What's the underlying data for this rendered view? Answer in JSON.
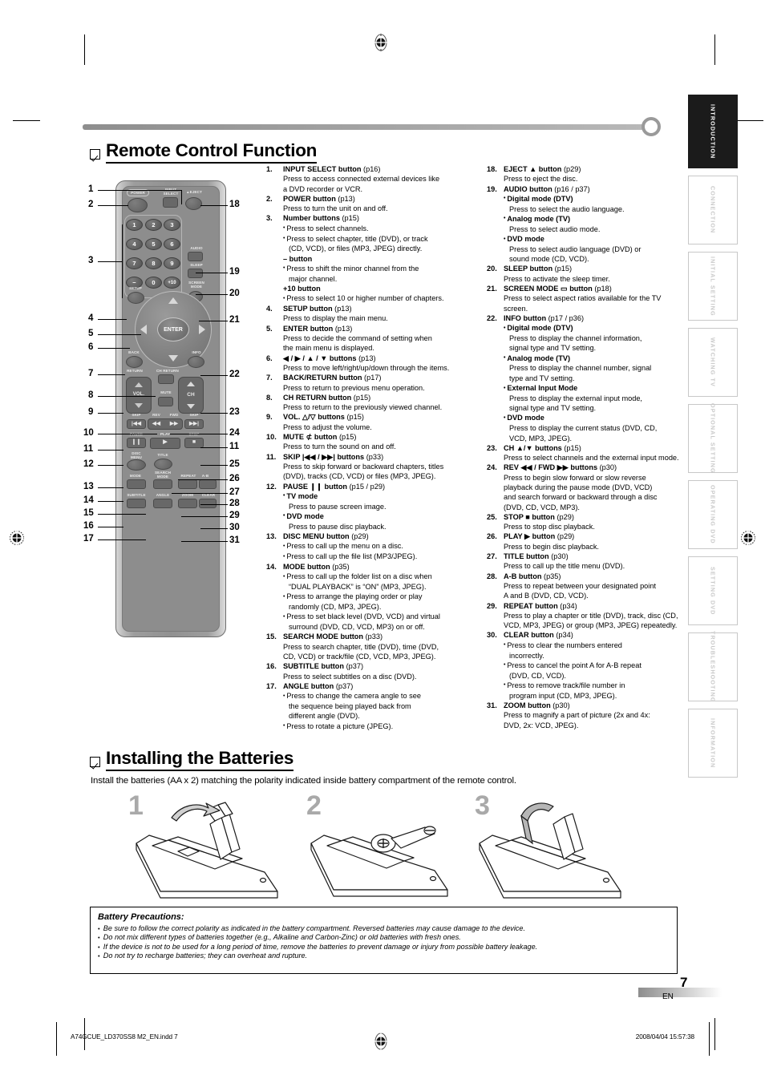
{
  "page": {
    "number": "7",
    "language": "EN",
    "footer_file": "A74GCUE_LD370SS8 M2_EN.indd   7",
    "footer_timestamp": "2008/04/04   15:57:38"
  },
  "side_tabs": [
    {
      "label": "INTRODUCTION",
      "active": true
    },
    {
      "label": "CONNECTION",
      "active": false
    },
    {
      "label": "INITIAL  SETTING",
      "active": false
    },
    {
      "label": "WATCHING  TV",
      "active": false
    },
    {
      "label": "OPTIONAL  SETTING",
      "active": false
    },
    {
      "label": "OPERATING  DVD",
      "active": false
    },
    {
      "label": "SETTING  DVD",
      "active": false
    },
    {
      "label": "TROUBLESHOOTING",
      "active": false
    },
    {
      "label": "INFORMATION",
      "active": false
    }
  ],
  "section1": {
    "title": "Remote Control Function"
  },
  "section2": {
    "title": "Installing the Batteries",
    "intro": "Install the batteries (AA x 2) matching the polarity indicated inside battery compartment of the remote control.",
    "steps": [
      "1",
      "2",
      "3"
    ]
  },
  "precautions": {
    "title": "Battery Precautions:",
    "items": [
      "Be sure to follow the correct polarity as indicated in the battery compartment. Reversed batteries may cause damage to the device.",
      "Do not mix different types of batteries together (e.g., Alkaline and Carbon-Zinc) or old batteries with fresh ones.",
      "If the device is not to be used for a long period of time, remove the batteries to prevent damage or injury from possible battery leakage.",
      "Do not try to recharge batteries; they can overheat and rupture."
    ]
  },
  "remote_labels": {
    "power": "POWER",
    "input_select": "INPUT\nSELECT",
    "eject": "▲EJECT",
    "audio": "AUDIO",
    "sleep": "SLEEP",
    "screen_mode": "SCREEN\nMODE",
    "setup": "SETUP",
    "enter": "ENTER",
    "back": "BACK",
    "return": "RETURN",
    "info": "INFO",
    "ch_return": "CH RETURN",
    "vol": "VOL.",
    "mute": "MUTE",
    "ch": "CH",
    "skip_left": "SKIP",
    "skip_right": "SKIP",
    "rev": "REV",
    "fwd": "FWD",
    "pause": "PAUSE",
    "play": "PLAY",
    "stop": "STOP",
    "disc_menu": "DISC\nMENU",
    "title": "TITLE",
    "mode": "MODE",
    "search_mode": "SEARCH\nMODE",
    "repeat": "REPEAT",
    "ab": "A-B",
    "subtitle": "SUBTITLE",
    "angle": "ANGLE",
    "zoom": "ZOOM",
    "clear": "CLEAR",
    "keys": [
      "1",
      "2",
      "3",
      "4",
      "5",
      "6",
      "7",
      "8",
      "9",
      "−",
      "0",
      "+10"
    ]
  },
  "callouts": [
    "1",
    "2",
    "3",
    "4",
    "5",
    "6",
    "7",
    "8",
    "9",
    "10",
    "11",
    "12",
    "13",
    "14",
    "15",
    "16",
    "17",
    "18",
    "19",
    "20",
    "21",
    "22",
    "23",
    "24",
    "25",
    "26",
    "27",
    "28",
    "29",
    "30",
    "31",
    "11"
  ],
  "functions_left": [
    {
      "n": "1.",
      "title": "INPUT SELECT button",
      "page": "(p16)",
      "lines": [
        {
          "t": "plain",
          "v": "Press to access connected external devices like"
        },
        {
          "t": "plain",
          "v": "a DVD recorder or VCR."
        }
      ]
    },
    {
      "n": "2.",
      "title": "POWER button",
      "page": "(p13)",
      "lines": [
        {
          "t": "plain",
          "v": "Press to turn the unit on and off."
        }
      ]
    },
    {
      "n": "3.",
      "title": "Number buttons",
      "page": "(p15)",
      "lines": [
        {
          "t": "bullet",
          "v": "Press to select channels."
        },
        {
          "t": "bullet",
          "v": "Press to select chapter, title (DVD), or track"
        },
        {
          "t": "indent",
          "v": "(CD, VCD), or files (MP3, JPEG) directly."
        },
        {
          "t": "boldline",
          "v": "– button"
        },
        {
          "t": "bullet",
          "v": "Press to shift the minor channel from the"
        },
        {
          "t": "indent",
          "v": "major channel."
        },
        {
          "t": "boldline",
          "v": "+10 button"
        },
        {
          "t": "bullet",
          "v": "Press to select 10 or higher number of chapters."
        }
      ]
    },
    {
      "n": "4.",
      "title": "SETUP button",
      "page": "(p13)",
      "lines": [
        {
          "t": "plain",
          "v": "Press to display the main menu."
        }
      ]
    },
    {
      "n": "5.",
      "title": "ENTER button",
      "page": "(p13)",
      "lines": [
        {
          "t": "plain",
          "v": "Press to decide the command of setting when"
        },
        {
          "t": "plain",
          "v": "the main menu is displayed."
        }
      ]
    },
    {
      "n": "6.",
      "title": "◀ / ▶ / ▲ / ▼ buttons",
      "page": "(p13)",
      "lines": [
        {
          "t": "plain",
          "v": "Press to move left/right/up/down through the items."
        }
      ]
    },
    {
      "n": "7.",
      "title": "BACK/RETURN button",
      "page": "(p17)",
      "lines": [
        {
          "t": "plain",
          "v": "Press to return to previous menu operation."
        }
      ]
    },
    {
      "n": "8.",
      "title": "CH RETURN button",
      "page": "(p15)",
      "lines": [
        {
          "t": "plain",
          "v": "Press to return to the previously viewed channel."
        }
      ]
    },
    {
      "n": "9.",
      "title": "VOL. △/▽ buttons",
      "page": "(p15)",
      "lines": [
        {
          "t": "plain",
          "v": "Press to adjust the volume."
        }
      ]
    },
    {
      "n": "10.",
      "title": "MUTE ⊄ button",
      "page": "(p15)",
      "lines": [
        {
          "t": "plain",
          "v": "Press to turn the sound on and off."
        }
      ]
    },
    {
      "n": "11.",
      "title": "SKIP |◀◀ / ▶▶| buttons",
      "page": "(p33)",
      "lines": [
        {
          "t": "plain",
          "v": "Press to skip forward or backward chapters, titles"
        },
        {
          "t": "plain",
          "v": "(DVD), tracks (CD, VCD) or files (MP3, JPEG)."
        }
      ]
    },
    {
      "n": "12.",
      "title": "PAUSE ❙❙ button",
      "page": "(p15 / p29)",
      "lines": [
        {
          "t": "sub",
          "v": "TV mode"
        },
        {
          "t": "indent",
          "v": "Press to pause screen image."
        },
        {
          "t": "sub",
          "v": "DVD mode"
        },
        {
          "t": "indent",
          "v": "Press to pause disc playback."
        }
      ]
    },
    {
      "n": "13.",
      "title": "DISC MENU button",
      "page": "(p29)",
      "lines": [
        {
          "t": "bullet",
          "v": "Press to call up the menu on a disc."
        },
        {
          "t": "bullet",
          "v": "Press to call up the file list (MP3/JPEG)."
        }
      ]
    },
    {
      "n": "14.",
      "title": "MODE button",
      "page": "(p35)",
      "lines": [
        {
          "t": "bullet",
          "v": "Press to call up the folder list on a disc when"
        },
        {
          "t": "indent",
          "v": "“DUAL PLAYBACK” is “ON” (MP3, JPEG)."
        },
        {
          "t": "bullet",
          "v": "Press to arrange the playing order or play"
        },
        {
          "t": "indent",
          "v": "randomly (CD, MP3, JPEG)."
        },
        {
          "t": "bullet",
          "v": "Press to set black level (DVD, VCD) and virtual"
        },
        {
          "t": "indent",
          "v": "surround (DVD, CD, VCD, MP3) on or off."
        }
      ]
    },
    {
      "n": "15.",
      "title": "SEARCH MODE button",
      "page": "(p33)",
      "lines": [
        {
          "t": "plain",
          "v": "Press to search chapter, title (DVD), time (DVD,"
        },
        {
          "t": "plain",
          "v": "CD, VCD) or track/file (CD, VCD, MP3, JPEG)."
        }
      ]
    },
    {
      "n": "16.",
      "title": "SUBTITLE button",
      "page": "(p37)",
      "lines": [
        {
          "t": "plain",
          "v": "Press to select subtitles on a disc (DVD)."
        }
      ]
    },
    {
      "n": "17.",
      "title": "ANGLE button",
      "page": "(p37)",
      "lines": [
        {
          "t": "bullet",
          "v": "Press to change the camera angle to see"
        },
        {
          "t": "indent",
          "v": "the sequence being played back from"
        },
        {
          "t": "indent",
          "v": "different angle (DVD)."
        },
        {
          "t": "bullet",
          "v": "Press to rotate a picture (JPEG)."
        }
      ]
    }
  ],
  "functions_right": [
    {
      "n": "18.",
      "title": "EJECT ▲ button",
      "page": "(p29)",
      "lines": [
        {
          "t": "plain",
          "v": "Press to eject the disc."
        }
      ]
    },
    {
      "n": "19.",
      "title": "AUDIO button",
      "page": "(p16 / p37)",
      "lines": [
        {
          "t": "sub",
          "v": "Digital mode (DTV)"
        },
        {
          "t": "indent",
          "v": "Press to select the audio language."
        },
        {
          "t": "sub",
          "v": "Analog mode (TV)"
        },
        {
          "t": "indent",
          "v": "Press to select audio mode."
        },
        {
          "t": "sub",
          "v": "DVD mode"
        },
        {
          "t": "indent",
          "v": "Press to select audio language (DVD) or"
        },
        {
          "t": "indent",
          "v": "sound mode (CD, VCD)."
        }
      ]
    },
    {
      "n": "20.",
      "title": "SLEEP button",
      "page": "(p15)",
      "lines": [
        {
          "t": "plain",
          "v": "Press to activate the sleep timer."
        }
      ]
    },
    {
      "n": "21.",
      "title": "SCREEN MODE ▭ button",
      "page": "(p18)",
      "lines": [
        {
          "t": "plain",
          "v": "Press to select aspect ratios available for the TV screen."
        }
      ]
    },
    {
      "n": "22.",
      "title": "INFO button",
      "page": "(p17 / p36)",
      "lines": [
        {
          "t": "sub",
          "v": "Digital mode (DTV)"
        },
        {
          "t": "indent",
          "v": "Press to display the channel information,"
        },
        {
          "t": "indent",
          "v": "signal type and TV setting."
        },
        {
          "t": "sub",
          "v": "Analog mode (TV)"
        },
        {
          "t": "indent",
          "v": "Press to display the channel number, signal"
        },
        {
          "t": "indent",
          "v": "type and TV setting."
        },
        {
          "t": "sub",
          "v": "External Input Mode"
        },
        {
          "t": "indent",
          "v": "Press to display the external input mode,"
        },
        {
          "t": "indent",
          "v": "signal type and TV setting."
        },
        {
          "t": "sub",
          "v": "DVD mode"
        },
        {
          "t": "indent",
          "v": "Press to display the current status (DVD, CD,"
        },
        {
          "t": "indent",
          "v": "VCD, MP3, JPEG)."
        }
      ]
    },
    {
      "n": "23.",
      "title": "CH ▲/▼ buttons",
      "page": "(p15)",
      "lines": [
        {
          "t": "plain",
          "v": "Press to select channels and the external input mode."
        }
      ]
    },
    {
      "n": "24.",
      "title": "REV ◀◀ / FWD ▶▶ buttons",
      "page": "(p30)",
      "lines": [
        {
          "t": "plain",
          "v": "Press to begin slow forward or slow reverse"
        },
        {
          "t": "plain",
          "v": "playback during the pause mode (DVD, VCD)"
        },
        {
          "t": "plain",
          "v": "and search forward or backward through a disc"
        },
        {
          "t": "plain",
          "v": "(DVD, CD, VCD, MP3)."
        }
      ]
    },
    {
      "n": "25.",
      "title": "STOP ■ button",
      "page": "(p29)",
      "lines": [
        {
          "t": "plain",
          "v": "Press to stop disc playback."
        }
      ]
    },
    {
      "n": "26.",
      "title": "PLAY ▶ button",
      "page": "(p29)",
      "lines": [
        {
          "t": "plain",
          "v": "Press to begin disc playback."
        }
      ]
    },
    {
      "n": "27.",
      "title": "TITLE button",
      "page": "(p30)",
      "lines": [
        {
          "t": "plain",
          "v": "Press to call up the title menu (DVD)."
        }
      ]
    },
    {
      "n": "28.",
      "title": "A-B button",
      "page": "(p35)",
      "lines": [
        {
          "t": "plain",
          "v": "Press to repeat between your designated point"
        },
        {
          "t": "plain",
          "v": "A and B (DVD, CD, VCD)."
        }
      ]
    },
    {
      "n": "29.",
      "title": "REPEAT button",
      "page": "(p34)",
      "lines": [
        {
          "t": "plain",
          "v": "Press to play a chapter or title (DVD), track, disc (CD,"
        },
        {
          "t": "plain",
          "v": "VCD, MP3, JPEG) or group (MP3, JPEG) repeatedly."
        }
      ]
    },
    {
      "n": "30.",
      "title": "CLEAR button",
      "page": "(p34)",
      "lines": [
        {
          "t": "bullet",
          "v": "Press to clear the numbers entered"
        },
        {
          "t": "indent",
          "v": "incorrectly."
        },
        {
          "t": "bullet",
          "v": "Press to cancel the point A for A-B repeat"
        },
        {
          "t": "indent",
          "v": "(DVD, CD, VCD)."
        },
        {
          "t": "bullet",
          "v": "Press to remove track/file number in"
        },
        {
          "t": "indent",
          "v": "program input (CD, MP3, JPEG)."
        }
      ]
    },
    {
      "n": "31.",
      "title": "ZOOM button",
      "page": "(p30)",
      "lines": [
        {
          "t": "plain",
          "v": "Press to magnify a part of picture (2x and 4x:"
        },
        {
          "t": "plain",
          "v": "DVD, 2x: VCD, JPEG)."
        }
      ]
    }
  ]
}
